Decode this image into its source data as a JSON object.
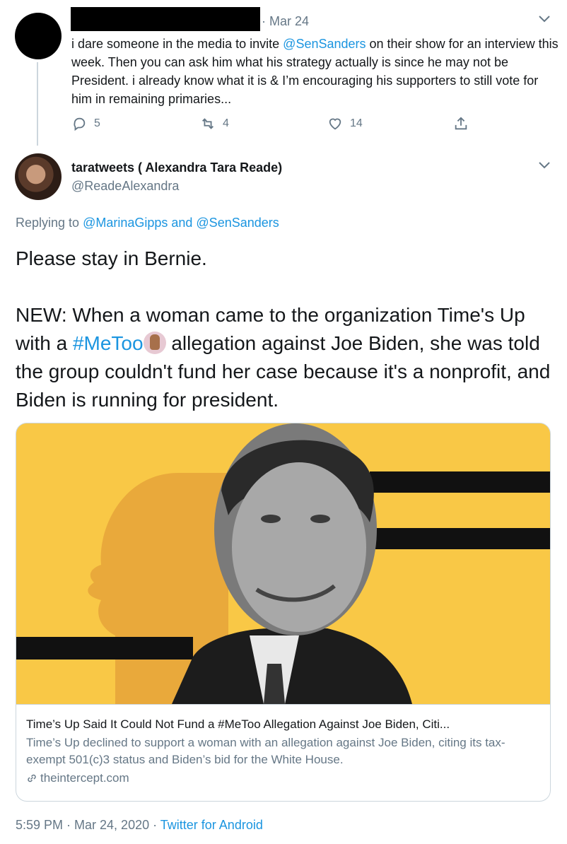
{
  "parent_tweet": {
    "date": "· Mar 24",
    "text_parts": [
      "i dare someone in the media to invite ",
      "@SenSanders",
      " on their show for an interview this week. Then you can ask him what his strategy actually is since he may not be President. i already know what it is & I’m encouraging his supporters to still vote for him in remaining primaries..."
    ],
    "actions": {
      "reply_count": "5",
      "retweet_count": "4",
      "like_count": "14"
    },
    "icons": [
      "reply-icon",
      "retweet-icon",
      "like-icon",
      "share-icon",
      "chevron-down-icon"
    ]
  },
  "main_tweet": {
    "display_name": "taratweets ( Alexandra Tara Reade)",
    "handle": "@ReadeAlexandra",
    "replying_prefix": "Replying to ",
    "replying_users": "@MarinaGipps and @SenSanders",
    "text_line1": "Please stay in Bernie.",
    "text_parts": [
      "NEW: When a woman came to the organization Time's Up with a ",
      "#MeToo",
      " allegation against Joe Biden, she was told the group couldn't fund her case because it's a nonprofit, and Biden is running for president."
    ],
    "card": {
      "title": "Time’s Up Said It Could Not Fund a #MeToo Allegation Against Joe Biden, Citi...",
      "description": "Time’s Up declined to support a woman with an allegation against Joe Biden, citing its tax-exempt 501(c)3 status and Biden’s bid for the White House.",
      "domain": "theintercept.com"
    },
    "timestamp": "5:59 PM · Mar 24, 2020 · ",
    "source": "Twitter for Android"
  },
  "colors": {
    "link": "#1b95e0",
    "muted": "#657786",
    "text": "#14171a",
    "card_background": "#f9c846"
  }
}
